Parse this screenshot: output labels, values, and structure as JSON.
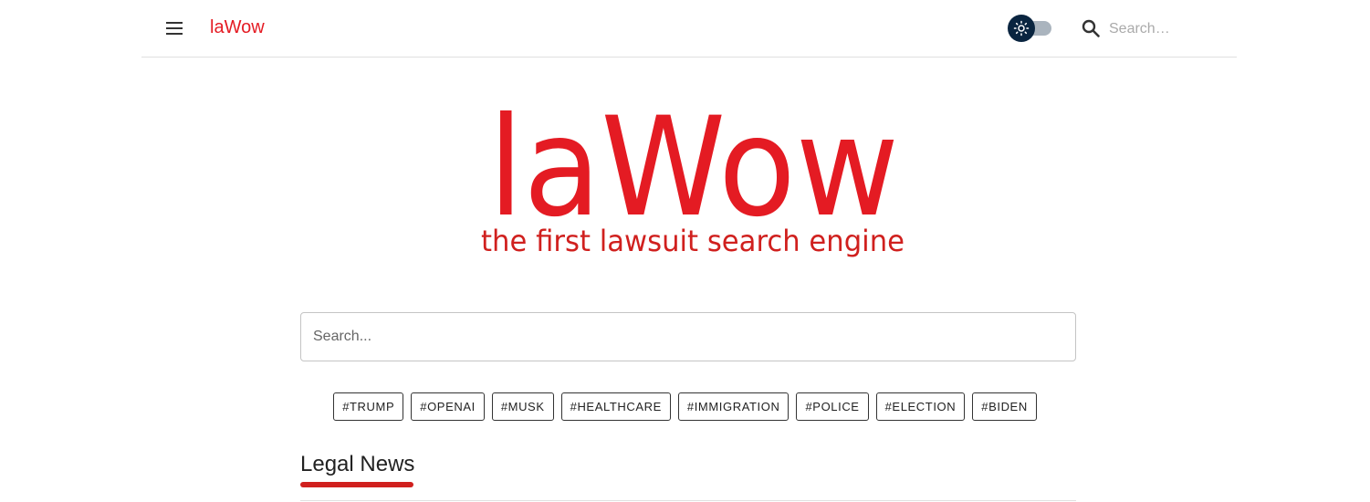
{
  "header": {
    "brand": "laWow",
    "search_placeholder": "Search…"
  },
  "logo": {
    "wordmark": "laWow",
    "tagline": "the first lawsuit search engine"
  },
  "main_search": {
    "placeholder": "Search...",
    "value": ""
  },
  "tags": [
    "#TRUMP",
    "#OPENAI",
    "#MUSK",
    "#HEALTHCARE",
    "#IMMIGRATION",
    "#POLICE",
    "#ELECTION",
    "#BIDEN"
  ],
  "news": {
    "title": "Legal News"
  },
  "theme": {
    "brand_color": "#e41b23",
    "toggle_knob_color": "#0a2540",
    "toggle_track_color": "#aab4be",
    "theme_mode": "light"
  },
  "icons": {
    "menu": "menu-icon",
    "theme": "sun-icon",
    "search": "search-icon"
  }
}
